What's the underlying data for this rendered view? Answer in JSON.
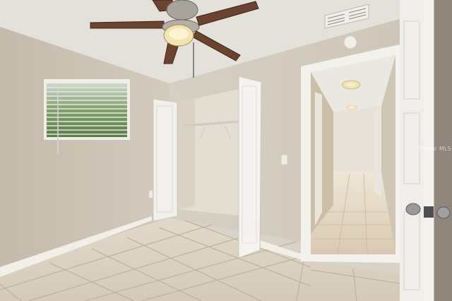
{
  "photo": {
    "scene": "empty-bedroom-interior",
    "watermark_text": "Stellar MLS"
  },
  "colors": {
    "wall": "#cbc2b4",
    "ceiling": "#e6e3dc",
    "tile": "#ddd3c4",
    "grout": "#b7ab99",
    "door": "#f2f1ee",
    "fan_blade": "#6b4330",
    "trim": "#f3f1ec"
  },
  "icons": [
    "ceiling-fan-icon",
    "window-blinds",
    "closet-door",
    "hallway-light",
    "door-knob-icon"
  ]
}
